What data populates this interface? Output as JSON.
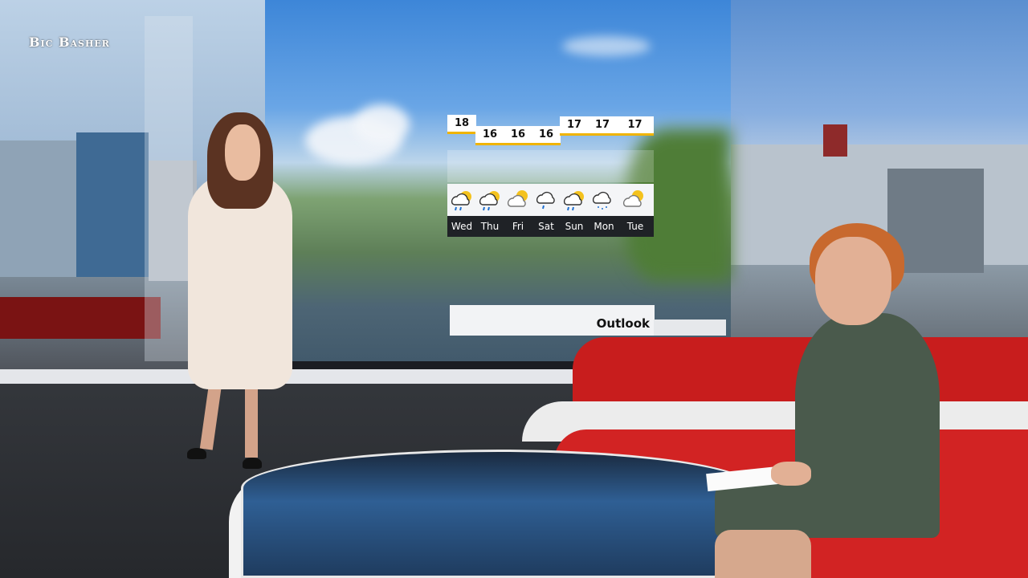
{
  "watermark": "Bic Basher",
  "forecast": {
    "temps": [
      "18",
      "16",
      "16",
      "16",
      "17",
      "17",
      "17"
    ],
    "days": [
      "Wed",
      "Thu",
      "Fri",
      "Sat",
      "Sun",
      "Mon",
      "Tue"
    ],
    "icons": [
      "sunny-intervals-rain-icon",
      "sunny-intervals-rain-icon",
      "sunny-intervals-icon",
      "light-rain-icon",
      "sunny-intervals-rain-icon",
      "drizzle-icon",
      "sunny-intervals-icon"
    ],
    "outlook": "Outlook"
  },
  "colors": {
    "temp_underline": "#f0b400",
    "sofa_red": "#c81d1d",
    "day_strip": "#1f2226"
  }
}
